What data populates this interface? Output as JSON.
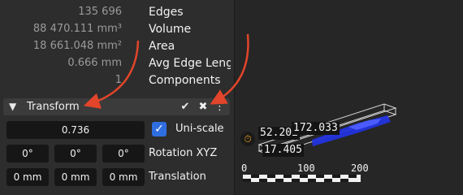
{
  "stats": [
    {
      "value": "135 696",
      "label": "Edges"
    },
    {
      "value": "88 470.111 mm³",
      "label": "Volume"
    },
    {
      "value": "18 661.048 mm²",
      "label": "Area"
    },
    {
      "value": "0.666 mm",
      "label": "Avg Edge Length"
    },
    {
      "value": "1",
      "label": "Components"
    }
  ],
  "transform": {
    "title": "Transform",
    "scale_value": "0.736",
    "uni_scale_label": "Uni-scale",
    "uni_scale_checked": true,
    "rotation": [
      "0°",
      "0°",
      "0°"
    ],
    "rotation_label": "Rotation XYZ",
    "translation": [
      "0 mm",
      "0 mm",
      "0 mm"
    ],
    "translation_label": "Translation"
  },
  "viewport": {
    "dim_x": "172.033",
    "dim_y": "52.202",
    "dim_z": "17.405",
    "scale_ticks": [
      "0",
      "100",
      "200"
    ]
  },
  "colors": {
    "accent": "#2f6ee0",
    "arrow": "#e2452a",
    "model": "#2233dd"
  }
}
